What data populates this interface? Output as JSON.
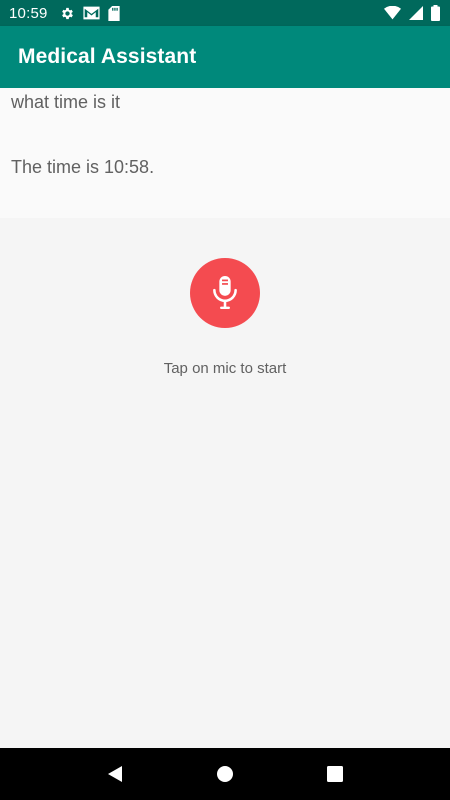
{
  "status_bar": {
    "time": "10:59",
    "icons": [
      "gear-icon",
      "gmail-icon",
      "sd-card-icon",
      "wifi-icon",
      "cell-signal-icon",
      "battery-icon"
    ]
  },
  "app_bar": {
    "title": "Medical Assistant",
    "color": "#00897b"
  },
  "conversation": {
    "messages": [
      {
        "role": "user",
        "text": "what time is it"
      },
      {
        "role": "assistant",
        "text": "The time is 10:58."
      }
    ]
  },
  "mic": {
    "icon": "microphone-icon",
    "color": "#f44b50",
    "hint": "Tap on mic to start"
  },
  "nav_bar": {
    "buttons": [
      "back-icon",
      "home-icon",
      "recents-icon"
    ]
  }
}
